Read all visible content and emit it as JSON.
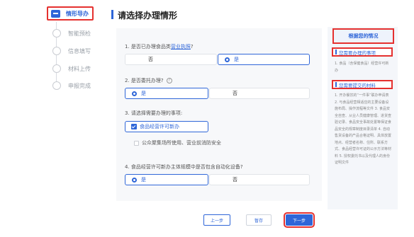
{
  "steps": [
    {
      "label": "情形导办",
      "active": true
    },
    {
      "label": "智能预检"
    },
    {
      "label": "信息填写"
    },
    {
      "label": "材料上传"
    },
    {
      "label": "申报完成"
    }
  ],
  "header": {
    "title": "请选择办理情形"
  },
  "questions": {
    "q1": {
      "prefix": "1. 是否已办理食品类",
      "link": "营业执照",
      "suffix": "?",
      "options": [
        "否",
        "是"
      ],
      "selected": "是"
    },
    "q2": {
      "text": "2. 是否委托办理?",
      "help": "?",
      "options": [
        "是",
        "否"
      ],
      "selected": "是"
    },
    "q3": {
      "text": "3. 请选择需要办理的事项:",
      "options": [
        "食品经营许可新办",
        "公众聚集场所使用、营业前消防安全"
      ],
      "selected": "食品经营许可新办"
    },
    "q4": {
      "text": "4. 食品经营许可新办主体规模中是否包含自动化设备?",
      "options": [
        "是",
        "否"
      ],
      "selected": "是"
    }
  },
  "buttons": {
    "prev": "上一步",
    "save": "暂存",
    "next": "下一步"
  },
  "panel": {
    "title": "根据您的情况",
    "section1": "您需要办理的事项",
    "items1": "1. 食品（含保健食品）经营许可新办",
    "section2": "您需要提交的材料",
    "items2": "1. 开办餐饮的“一件事”联办申请表 2. 与食品经营相适应的主要设备设施布局、操作流程等文件 3. 食品安全自查、从业人员健康管理、进货查验记录、食品安全事故处置等保证食品安全的规章制度目录清单 4. 自动售货设备的产品合格证明、具体放置地点、经营者名称、住所、联系方式、食品经营许可证的公示方法等材料 5. 授权委托书以及代理人的身份证明文件"
  },
  "colors": {
    "accent": "#2f66d8",
    "highlight": "#e5312f"
  }
}
